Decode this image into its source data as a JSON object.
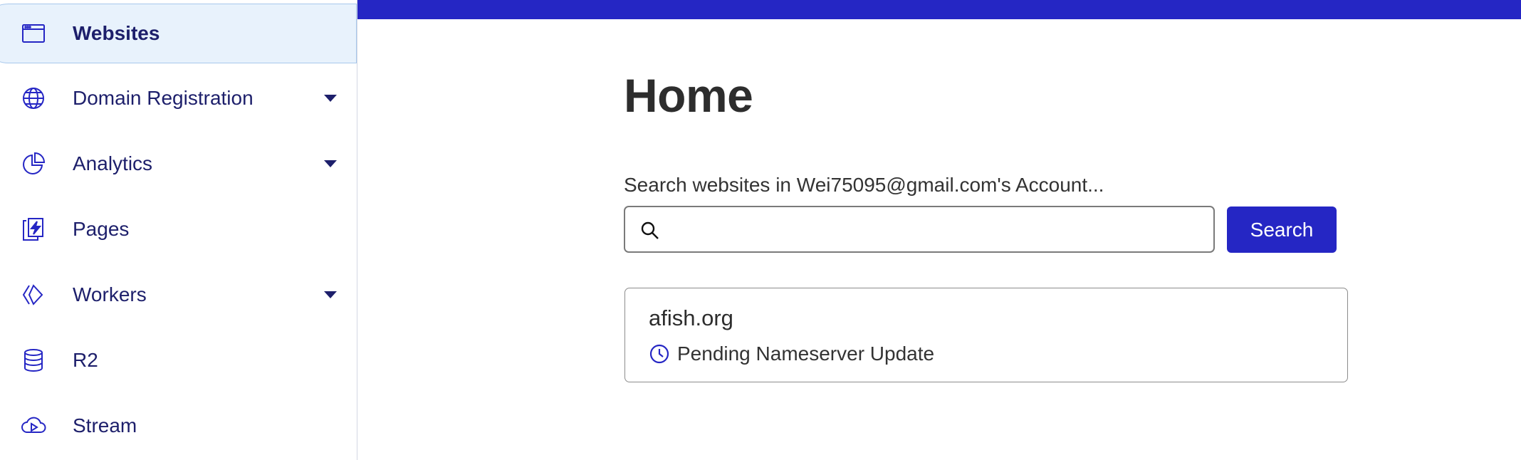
{
  "sidebar": {
    "items": [
      {
        "label": "Websites",
        "icon": "browser-window-icon",
        "active": true,
        "has_caret": false
      },
      {
        "label": "Domain Registration",
        "icon": "globe-www-icon",
        "active": false,
        "has_caret": true
      },
      {
        "label": "Analytics",
        "icon": "pie-chart-icon",
        "active": false,
        "has_caret": true
      },
      {
        "label": "Pages",
        "icon": "pages-lightning-icon",
        "active": false,
        "has_caret": false
      },
      {
        "label": "Workers",
        "icon": "workers-diamond-icon",
        "active": false,
        "has_caret": true
      },
      {
        "label": "R2",
        "icon": "database-icon",
        "active": false,
        "has_caret": false
      },
      {
        "label": "Stream",
        "icon": "cloud-play-icon",
        "active": false,
        "has_caret": false
      }
    ]
  },
  "main": {
    "title": "Home",
    "search": {
      "label": "Search websites in Wei75095@gmail.com's Account...",
      "value": "",
      "placeholder": "",
      "button_label": "Search"
    },
    "sites": [
      {
        "name": "afish.org",
        "status": "Pending Nameserver Update",
        "status_icon": "clock-icon"
      }
    ]
  },
  "colors": {
    "accent": "#2526c4",
    "nav_text": "#1d1f6b",
    "active_bg": "#e8f2fc"
  }
}
